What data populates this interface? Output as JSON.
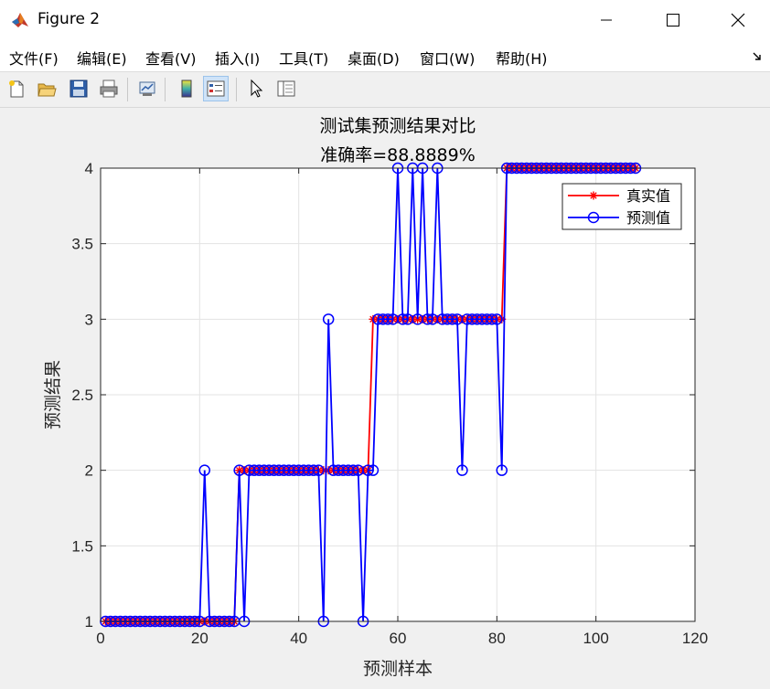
{
  "window": {
    "title": "Figure 2",
    "icon": "matlab-logo-icon"
  },
  "menu": {
    "items": [
      "文件(F)",
      "编辑(E)",
      "查看(V)",
      "插入(I)",
      "工具(T)",
      "桌面(D)",
      "窗口(W)",
      "帮助(H)"
    ]
  },
  "toolbar": {
    "buttons": [
      "new-figure-icon",
      "open-file-icon",
      "save-icon",
      "print-icon",
      "link-plot-icon",
      "insert-colorbar-icon",
      "insert-legend-icon",
      "edit-plot-icon",
      "property-inspector-icon"
    ]
  },
  "chart_data": {
    "type": "line",
    "title": "测试集预测结果对比",
    "subtitle": "准确率=88.8889%",
    "xlabel": "预测样本",
    "ylabel": "预测结果",
    "xlim": [
      0,
      120
    ],
    "ylim": [
      1,
      4
    ],
    "xticks": [
      0,
      20,
      40,
      60,
      80,
      100,
      120
    ],
    "yticks": [
      1,
      1.5,
      2,
      2.5,
      3,
      3.5,
      4
    ],
    "grid": true,
    "legend_position": "top-right",
    "series": [
      {
        "name": "真实值",
        "color": "#ff0000",
        "marker": "asterisk",
        "x": [
          1,
          2,
          3,
          4,
          5,
          6,
          7,
          8,
          9,
          10,
          11,
          12,
          13,
          14,
          15,
          16,
          17,
          18,
          19,
          20,
          21,
          22,
          23,
          24,
          25,
          26,
          27,
          28,
          29,
          30,
          31,
          32,
          33,
          34,
          35,
          36,
          37,
          38,
          39,
          40,
          41,
          42,
          43,
          44,
          45,
          46,
          47,
          48,
          49,
          50,
          51,
          52,
          53,
          54,
          55,
          56,
          57,
          58,
          59,
          60,
          61,
          62,
          63,
          64,
          65,
          66,
          67,
          68,
          69,
          70,
          71,
          72,
          73,
          74,
          75,
          76,
          77,
          78,
          79,
          80,
          81,
          82,
          83,
          84,
          85,
          86,
          87,
          88,
          89,
          90,
          91,
          92,
          93,
          94,
          95,
          96,
          97,
          98,
          99,
          100,
          101,
          102,
          103,
          104,
          105,
          106,
          107,
          108
        ],
        "y": [
          1,
          1,
          1,
          1,
          1,
          1,
          1,
          1,
          1,
          1,
          1,
          1,
          1,
          1,
          1,
          1,
          1,
          1,
          1,
          1,
          1,
          1,
          1,
          1,
          1,
          1,
          1,
          2,
          2,
          2,
          2,
          2,
          2,
          2,
          2,
          2,
          2,
          2,
          2,
          2,
          2,
          2,
          2,
          2,
          2,
          2,
          2,
          2,
          2,
          2,
          2,
          2,
          2,
          2,
          3,
          3,
          3,
          3,
          3,
          3,
          3,
          3,
          3,
          3,
          3,
          3,
          3,
          3,
          3,
          3,
          3,
          3,
          3,
          3,
          3,
          3,
          3,
          3,
          3,
          3,
          3,
          4,
          4,
          4,
          4,
          4,
          4,
          4,
          4,
          4,
          4,
          4,
          4,
          4,
          4,
          4,
          4,
          4,
          4,
          4,
          4,
          4,
          4,
          4,
          4,
          4,
          4,
          4
        ]
      },
      {
        "name": "预测值",
        "color": "#0000ff",
        "marker": "circle",
        "x": [
          1,
          2,
          3,
          4,
          5,
          6,
          7,
          8,
          9,
          10,
          11,
          12,
          13,
          14,
          15,
          16,
          17,
          18,
          19,
          20,
          21,
          22,
          23,
          24,
          25,
          26,
          27,
          28,
          29,
          30,
          31,
          32,
          33,
          34,
          35,
          36,
          37,
          38,
          39,
          40,
          41,
          42,
          43,
          44,
          45,
          46,
          47,
          48,
          49,
          50,
          51,
          52,
          53,
          54,
          55,
          56,
          57,
          58,
          59,
          60,
          61,
          62,
          63,
          64,
          65,
          66,
          67,
          68,
          69,
          70,
          71,
          72,
          73,
          74,
          75,
          76,
          77,
          78,
          79,
          80,
          81,
          82,
          83,
          84,
          85,
          86,
          87,
          88,
          89,
          90,
          91,
          92,
          93,
          94,
          95,
          96,
          97,
          98,
          99,
          100,
          101,
          102,
          103,
          104,
          105,
          106,
          107,
          108
        ],
        "y": [
          1,
          1,
          1,
          1,
          1,
          1,
          1,
          1,
          1,
          1,
          1,
          1,
          1,
          1,
          1,
          1,
          1,
          1,
          1,
          1,
          2,
          1,
          1,
          1,
          1,
          1,
          1,
          2,
          1,
          2,
          2,
          2,
          2,
          2,
          2,
          2,
          2,
          2,
          2,
          2,
          2,
          2,
          2,
          2,
          1,
          3,
          2,
          2,
          2,
          2,
          2,
          2,
          1,
          2,
          2,
          3,
          3,
          3,
          3,
          4,
          3,
          3,
          4,
          3,
          4,
          3,
          3,
          4,
          3,
          3,
          3,
          3,
          2,
          3,
          3,
          3,
          3,
          3,
          3,
          3,
          2,
          4,
          4,
          4,
          4,
          4,
          4,
          4,
          4,
          4,
          4,
          4,
          4,
          4,
          4,
          4,
          4,
          4,
          4,
          4,
          4,
          4,
          4,
          4,
          4,
          4,
          4,
          4
        ]
      }
    ]
  }
}
